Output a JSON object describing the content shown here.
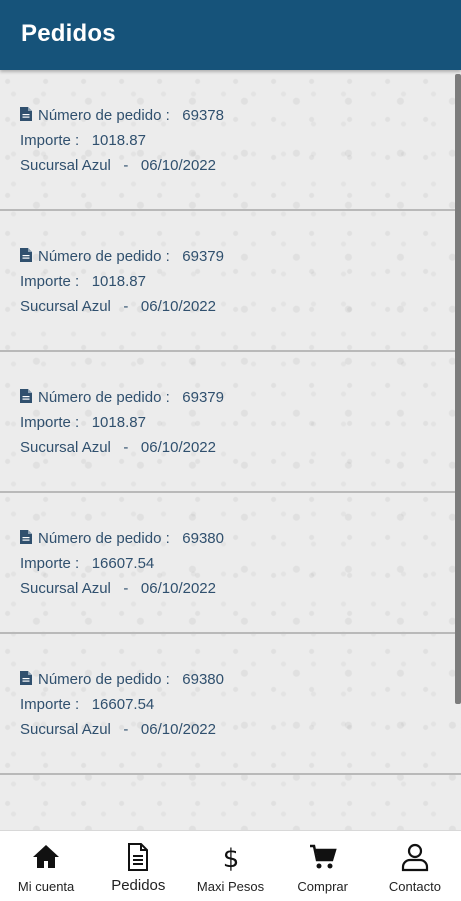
{
  "header": {
    "title": "Pedidos"
  },
  "orders": [
    {
      "numero_label": "Número de pedido :",
      "numero": "69378",
      "importe_label": "Importe :",
      "importe": "1018.87",
      "sucursal": "Sucursal Azul",
      "sep": "-",
      "fecha": "06/10/2022"
    },
    {
      "numero_label": "Número de pedido :",
      "numero": "69379",
      "importe_label": "Importe :",
      "importe": "1018.87",
      "sucursal": "Sucursal Azul",
      "sep": "-",
      "fecha": "06/10/2022"
    },
    {
      "numero_label": "Número de pedido :",
      "numero": "69379",
      "importe_label": "Importe :",
      "importe": "1018.87",
      "sucursal": "Sucursal Azul",
      "sep": "-",
      "fecha": "06/10/2022"
    },
    {
      "numero_label": "Número de pedido :",
      "numero": "69380",
      "importe_label": "Importe :",
      "importe": "16607.54",
      "sucursal": "Sucursal Azul",
      "sep": "-",
      "fecha": "06/10/2022"
    },
    {
      "numero_label": "Número de pedido :",
      "numero": "69380",
      "importe_label": "Importe :",
      "importe": "16607.54",
      "sucursal": "Sucursal Azul",
      "sep": "-",
      "fecha": "06/10/2022"
    }
  ],
  "tabs": [
    {
      "label": "Mi cuenta",
      "icon": "home-icon"
    },
    {
      "label": "Pedidos",
      "icon": "document-icon",
      "active": true
    },
    {
      "label": "Maxi Pesos",
      "icon": "dollar-icon"
    },
    {
      "label": "Comprar",
      "icon": "cart-icon"
    },
    {
      "label": "Contacto",
      "icon": "user-icon"
    }
  ],
  "colors": {
    "header_bg": "#16537a",
    "text": "#30506e",
    "background": "#ececec"
  }
}
